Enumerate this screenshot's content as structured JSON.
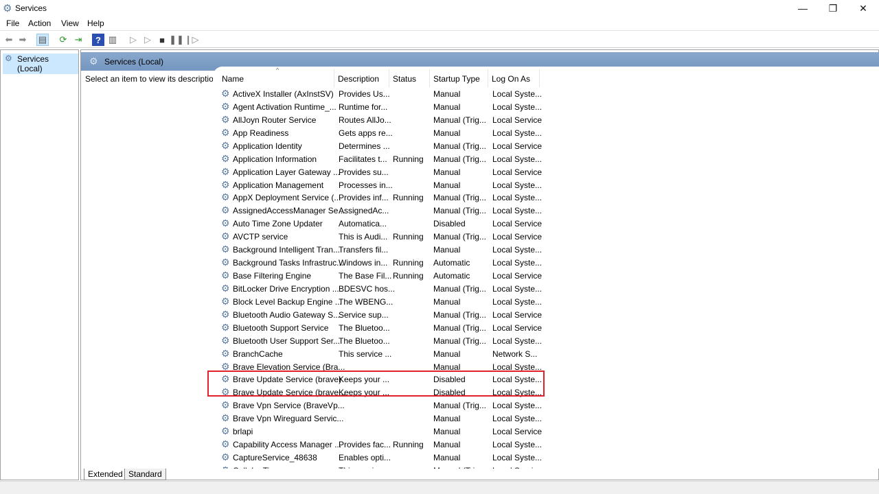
{
  "window": {
    "title": "Services",
    "minimize": "—",
    "restore": "❐",
    "close": "✕"
  },
  "menu": [
    "File",
    "Action",
    "View",
    "Help"
  ],
  "toolbar": [
    "back-icon",
    "forward-icon",
    "show-hide-console-tree-icon",
    "refresh-icon",
    "export-list-icon",
    "help-icon",
    "properties-icon",
    "start-icon",
    "start-alt-icon",
    "stop-icon",
    "pause-icon",
    "restart-icon"
  ],
  "tree": {
    "item": "Services (Local)"
  },
  "main": {
    "header": "Services (Local)",
    "description_prompt": "Select an item to view its description."
  },
  "columns": [
    "Name",
    "Description",
    "Status",
    "Startup Type",
    "Log On As"
  ],
  "sort": {
    "column": "Name",
    "direction": "ascending"
  },
  "rows": [
    [
      "ActiveX Installer (AxInstSV)",
      "Provides Us...",
      "",
      "Manual",
      "Local Syste..."
    ],
    [
      "Agent Activation Runtime_...",
      "Runtime for...",
      "",
      "Manual",
      "Local Syste..."
    ],
    [
      "AllJoyn Router Service",
      "Routes AllJo...",
      "",
      "Manual (Trig...",
      "Local Service"
    ],
    [
      "App Readiness",
      "Gets apps re...",
      "",
      "Manual",
      "Local Syste..."
    ],
    [
      "Application Identity",
      "Determines ...",
      "",
      "Manual (Trig...",
      "Local Service"
    ],
    [
      "Application Information",
      "Facilitates t...",
      "Running",
      "Manual (Trig...",
      "Local Syste..."
    ],
    [
      "Application Layer Gateway ...",
      "Provides su...",
      "",
      "Manual",
      "Local Service"
    ],
    [
      "Application Management",
      "Processes in...",
      "",
      "Manual",
      "Local Syste..."
    ],
    [
      "AppX Deployment Service (...",
      "Provides inf...",
      "Running",
      "Manual (Trig...",
      "Local Syste..."
    ],
    [
      "AssignedAccessManager Se...",
      "AssignedAc...",
      "",
      "Manual (Trig...",
      "Local Syste..."
    ],
    [
      "Auto Time Zone Updater",
      "Automatica...",
      "",
      "Disabled",
      "Local Service"
    ],
    [
      "AVCTP service",
      "This is Audi...",
      "Running",
      "Manual (Trig...",
      "Local Service"
    ],
    [
      "Background Intelligent Tran...",
      "Transfers fil...",
      "",
      "Manual",
      "Local Syste..."
    ],
    [
      "Background Tasks Infrastruc...",
      "Windows in...",
      "Running",
      "Automatic",
      "Local Syste..."
    ],
    [
      "Base Filtering Engine",
      "The Base Fil...",
      "Running",
      "Automatic",
      "Local Service"
    ],
    [
      "BitLocker Drive Encryption ...",
      "BDESVC hos...",
      "",
      "Manual (Trig...",
      "Local Syste..."
    ],
    [
      "Block Level Backup Engine ...",
      "The WBENG...",
      "",
      "Manual",
      "Local Syste..."
    ],
    [
      "Bluetooth Audio Gateway S...",
      "Service sup...",
      "",
      "Manual (Trig...",
      "Local Service"
    ],
    [
      "Bluetooth Support Service",
      "The Bluetoo...",
      "",
      "Manual (Trig...",
      "Local Service"
    ],
    [
      "Bluetooth User Support Ser...",
      "The Bluetoo...",
      "",
      "Manual (Trig...",
      "Local Syste..."
    ],
    [
      "BranchCache",
      "This service ...",
      "",
      "Manual",
      "Network S..."
    ],
    [
      "Brave Elevation Service (Bra...",
      "",
      "",
      "Manual",
      "Local Syste..."
    ],
    [
      "Brave Update Service (brave)",
      "Keeps your ...",
      "",
      "Disabled",
      "Local Syste..."
    ],
    [
      "Brave Update Service (brave...",
      "Keeps your ...",
      "",
      "Disabled",
      "Local Syste..."
    ],
    [
      "Brave Vpn Service (BraveVp...",
      "",
      "",
      "Manual (Trig...",
      "Local Syste..."
    ],
    [
      "Brave Vpn Wireguard Servic...",
      "",
      "",
      "Manual",
      "Local Syste..."
    ],
    [
      "brlapi",
      "",
      "",
      "Manual",
      "Local Service"
    ],
    [
      "Capability Access Manager ...",
      "Provides fac...",
      "Running",
      "Manual",
      "Local Syste..."
    ],
    [
      "CaptureService_48638",
      "Enables opti...",
      "",
      "Manual",
      "Local Syste..."
    ],
    [
      "Cellular Time",
      "This service ...",
      "",
      "Manual (Trig...",
      "Local Service"
    ]
  ],
  "tabs": [
    "Extended",
    "Standard"
  ],
  "highlight_color": "#e0202a"
}
